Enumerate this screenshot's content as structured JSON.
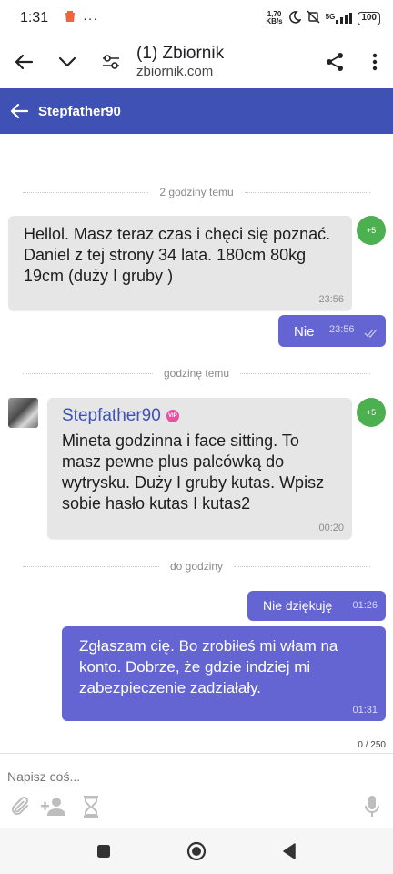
{
  "status_bar": {
    "time": "1:31",
    "dots": "···",
    "net_speed_value": "1,70",
    "net_speed_unit": "KB/s",
    "signal": "5G",
    "battery": "100"
  },
  "browser": {
    "title": "(1) Zbiornik",
    "url": "zbiornik.com"
  },
  "header": {
    "contact_name": "Stepfather90"
  },
  "messages": [
    {
      "type": "separator",
      "label": "2 godziny temu"
    },
    {
      "type": "incoming",
      "text": "Hellol. Masz teraz czas i chęci się poznać. Daniel z tej strony 34 lata. 180cm 80kg 19cm (duży I gruby )",
      "time": "23:56",
      "badge": "+5"
    },
    {
      "type": "outgoing",
      "text": "Nie",
      "time": "23:56"
    },
    {
      "type": "separator",
      "label": "godzinę temu"
    },
    {
      "type": "incoming",
      "sender": "Stepfather90",
      "vip_label": "VIP",
      "text": "Mineta godzinna i face sitting. To masz pewne plus palcówką do wytrysku. Duży I gruby kutas. Wpisz sobie hasło kutas I kutas2",
      "time": "00:20",
      "badge": "+5"
    },
    {
      "type": "separator",
      "label": "do godziny"
    },
    {
      "type": "outgoing",
      "text": "Nie dziękuję",
      "time": "01:26"
    },
    {
      "type": "outgoing",
      "text": "Zgłaszam cię. Bo zrobiłeś mi włam na konto. Dobrze, że gdzie indziej mi zabezpieczenie zadziałały.",
      "time": "01:31"
    }
  ],
  "composer": {
    "char_counter": "0 / 250",
    "placeholder": "Napisz coś..."
  },
  "colors": {
    "header": "#3f51b5",
    "outgoing_bubble": "#6464d2",
    "incoming_bubble": "#e6e6e6",
    "badge": "#4caf50"
  }
}
